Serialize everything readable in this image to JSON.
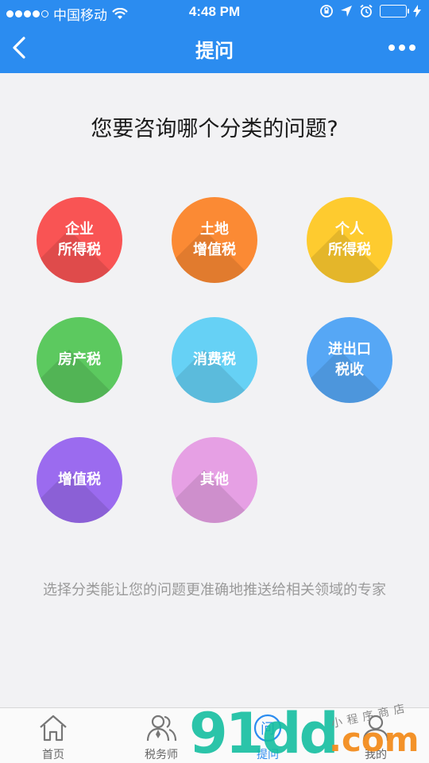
{
  "status_bar": {
    "carrier": "中国移动",
    "time": "4:48 PM"
  },
  "nav": {
    "title": "提问"
  },
  "question": "您要咨询哪个分类的问题?",
  "categories": [
    {
      "label": "企业\n所得税",
      "color": "#f95454"
    },
    {
      "label": "土地\n增值税",
      "color": "#fb8a34"
    },
    {
      "label": "个人\n所得税",
      "color": "#fecb2f"
    },
    {
      "label": "房产税",
      "color": "#5cc95f"
    },
    {
      "label": "消费税",
      "color": "#66d1f5"
    },
    {
      "label": "进出口\n税收",
      "color": "#56a7f5"
    },
    {
      "label": "增值税",
      "color": "#9b6bef"
    },
    {
      "label": "其他",
      "color": "#e6a0e4"
    }
  ],
  "hint": "选择分类能让您的问题更准确地推送给相关领域的专家",
  "tabs": [
    {
      "label": "首页",
      "icon": "home-icon",
      "active": false
    },
    {
      "label": "税务师",
      "icon": "advisors-icon",
      "active": false
    },
    {
      "label": "提问",
      "icon": "ask-icon",
      "active": true
    },
    {
      "label": "我的",
      "icon": "profile-icon",
      "active": false
    }
  ],
  "watermark": {
    "big": "91dd",
    "com": ".com",
    "small": "小程序商店"
  },
  "colors": {
    "brand": "#2b8cf0",
    "background": "#f2f2f4"
  }
}
